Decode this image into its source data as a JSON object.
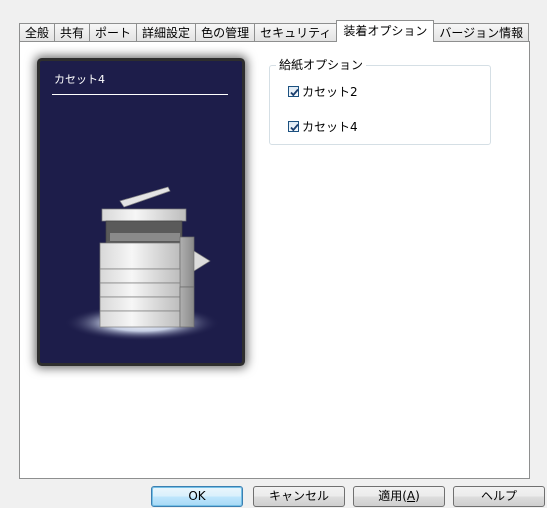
{
  "tabs": [
    {
      "label": "全般"
    },
    {
      "label": "共有"
    },
    {
      "label": "ポート"
    },
    {
      "label": "詳細設定"
    },
    {
      "label": "色の管理"
    },
    {
      "label": "セキュリティ"
    },
    {
      "label": "装着オプション",
      "active": true
    },
    {
      "label": "バージョン情報"
    }
  ],
  "preview": {
    "label": "カセット4",
    "image": "printer-with-two-cassettes"
  },
  "paper_options": {
    "legend": "給紙オプション",
    "items": [
      {
        "label": "カセット2",
        "checked": true
      },
      {
        "label": "カセット4",
        "checked": true
      }
    ]
  },
  "buttons": {
    "ok": "OK",
    "cancel": "キャンセル",
    "apply_prefix": "適用(",
    "apply_key": "A",
    "apply_suffix": ")",
    "help": "ヘルプ"
  },
  "colors": {
    "preview_background": "#1d1d4a",
    "checkbox_check": "#1c3f6e",
    "default_button_border": "#3c7fb1"
  }
}
